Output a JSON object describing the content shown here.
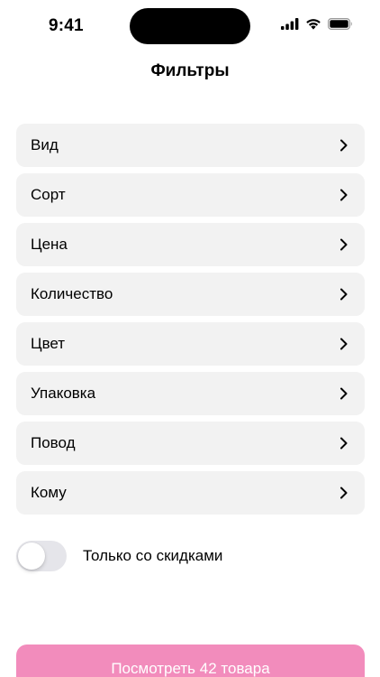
{
  "status_bar": {
    "time": "9:41",
    "icons": [
      "cellular-signal-icon",
      "wifi-icon",
      "battery-icon"
    ]
  },
  "header": {
    "title": "Фильтры"
  },
  "filters": {
    "items": [
      {
        "label": "Вид"
      },
      {
        "label": "Сорт"
      },
      {
        "label": "Цена"
      },
      {
        "label": "Количество"
      },
      {
        "label": "Цвет"
      },
      {
        "label": "Упаковка"
      },
      {
        "label": "Повод"
      },
      {
        "label": "Кому"
      }
    ]
  },
  "discount_toggle": {
    "label": "Только со скидками",
    "state": "off"
  },
  "footer": {
    "button_label": "Посмотреть 42 товара"
  },
  "colors": {
    "accent": "#f28cbc",
    "item_background": "#f2f2f2",
    "toggle_off": "#e5e5ea"
  }
}
